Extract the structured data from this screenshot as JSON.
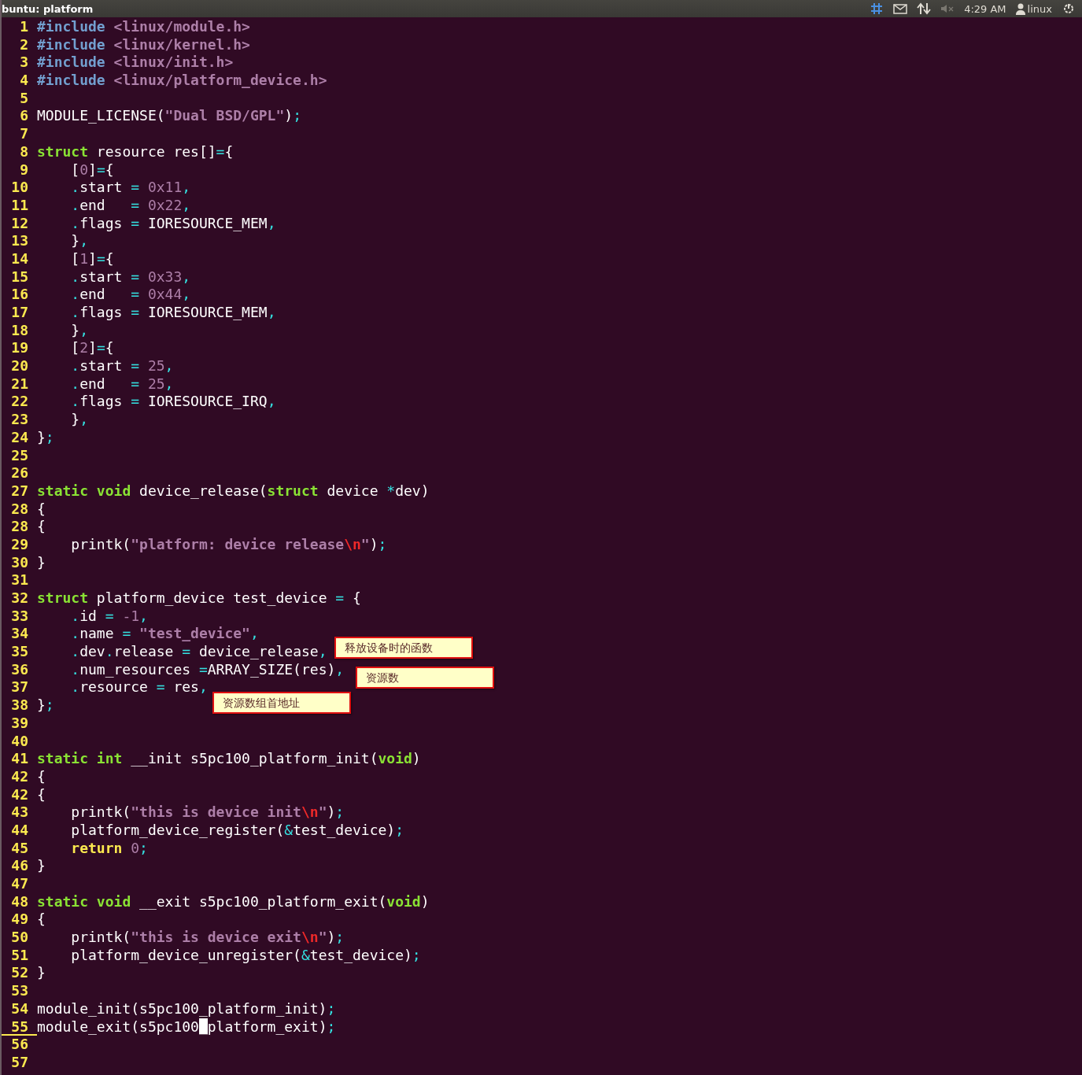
{
  "top_bar": {
    "title": "buntu: platform",
    "clock": "4:29 AM",
    "user": "linux"
  },
  "lines": [
    {
      "number": "1",
      "current": false,
      "tokens": [
        {
          "kind": "pre",
          "text": "#include"
        },
        {
          "kind": "str",
          "text": " <linux/module.h>"
        }
      ]
    },
    {
      "number": "2",
      "current": false,
      "tokens": [
        {
          "kind": "pre",
          "text": "#include"
        },
        {
          "kind": "str",
          "text": " <linux/kernel.h>"
        }
      ]
    },
    {
      "number": "3",
      "current": false,
      "tokens": [
        {
          "kind": "pre",
          "text": "#include"
        },
        {
          "kind": "str",
          "text": " <linux/init.h>"
        }
      ]
    },
    {
      "number": "4",
      "current": false,
      "tokens": [
        {
          "kind": "pre",
          "text": "#include"
        },
        {
          "kind": "str",
          "text": " <linux/platform_device.h>"
        }
      ]
    },
    {
      "number": "5",
      "current": false
    },
    {
      "number": "6",
      "current": false,
      "tokens": [
        {
          "kind": "plain",
          "text": "MODULE_LICENSE("
        },
        {
          "kind": "str",
          "text": "\"Dual BSD/GPL\""
        },
        {
          "kind": "plain",
          "text": ")"
        },
        {
          "kind": "op",
          "text": ";"
        }
      ]
    },
    {
      "number": "7",
      "current": false
    },
    {
      "number": "8",
      "current": false,
      "tokens": [
        {
          "kind": "kw",
          "text": "struct"
        },
        {
          "kind": "plain",
          "text": " resource res[]"
        },
        {
          "kind": "op",
          "text": "="
        },
        {
          "kind": "plain",
          "text": "{"
        }
      ]
    },
    {
      "number": "9",
      "current": false,
      "tokens": [
        {
          "kind": "plain",
          "text": "    ["
        },
        {
          "kind": "num",
          "text": "0"
        },
        {
          "kind": "plain",
          "text": "]"
        },
        {
          "kind": "op",
          "text": "="
        },
        {
          "kind": "plain",
          "text": "{"
        }
      ]
    },
    {
      "number": "10",
      "current": false,
      "tokens": [
        {
          "kind": "op",
          "text": "    ."
        },
        {
          "kind": "plain",
          "text": "start "
        },
        {
          "kind": "op",
          "text": "= "
        },
        {
          "kind": "num",
          "text": "0x11"
        },
        {
          "kind": "op",
          "text": ","
        }
      ]
    },
    {
      "number": "11",
      "current": false,
      "tokens": [
        {
          "kind": "op",
          "text": "    ."
        },
        {
          "kind": "plain",
          "text": "end   "
        },
        {
          "kind": "op",
          "text": "= "
        },
        {
          "kind": "num",
          "text": "0x22"
        },
        {
          "kind": "op",
          "text": ","
        }
      ]
    },
    {
      "number": "12",
      "current": false,
      "tokens": [
        {
          "kind": "op",
          "text": "    ."
        },
        {
          "kind": "plain",
          "text": "flags "
        },
        {
          "kind": "op",
          "text": "="
        },
        {
          "kind": "plain",
          "text": " IORESOURCE_MEM"
        },
        {
          "kind": "op",
          "text": ","
        }
      ]
    },
    {
      "number": "13",
      "current": false,
      "tokens": [
        {
          "kind": "plain",
          "text": "    }"
        },
        {
          "kind": "op",
          "text": ","
        }
      ]
    },
    {
      "number": "14",
      "current": false,
      "tokens": [
        {
          "kind": "plain",
          "text": "    ["
        },
        {
          "kind": "num",
          "text": "1"
        },
        {
          "kind": "plain",
          "text": "]"
        },
        {
          "kind": "op",
          "text": "="
        },
        {
          "kind": "plain",
          "text": "{"
        }
      ]
    },
    {
      "number": "15",
      "current": false,
      "tokens": [
        {
          "kind": "op",
          "text": "    ."
        },
        {
          "kind": "plain",
          "text": "start "
        },
        {
          "kind": "op",
          "text": "= "
        },
        {
          "kind": "num",
          "text": "0x33"
        },
        {
          "kind": "op",
          "text": ","
        }
      ]
    },
    {
      "number": "16",
      "current": false,
      "tokens": [
        {
          "kind": "op",
          "text": "    ."
        },
        {
          "kind": "plain",
          "text": "end   "
        },
        {
          "kind": "op",
          "text": "= "
        },
        {
          "kind": "num",
          "text": "0x44"
        },
        {
          "kind": "op",
          "text": ","
        }
      ]
    },
    {
      "number": "17",
      "current": false,
      "tokens": [
        {
          "kind": "op",
          "text": "    ."
        },
        {
          "kind": "plain",
          "text": "flags "
        },
        {
          "kind": "op",
          "text": "="
        },
        {
          "kind": "plain",
          "text": " IORESOURCE_MEM"
        },
        {
          "kind": "op",
          "text": ","
        }
      ]
    },
    {
      "number": "18",
      "current": false,
      "tokens": [
        {
          "kind": "plain",
          "text": "    }"
        },
        {
          "kind": "op",
          "text": ","
        }
      ]
    },
    {
      "number": "19",
      "current": false,
      "tokens": [
        {
          "kind": "plain",
          "text": "    ["
        },
        {
          "kind": "num",
          "text": "2"
        },
        {
          "kind": "plain",
          "text": "]"
        },
        {
          "kind": "op",
          "text": "="
        },
        {
          "kind": "plain",
          "text": "{"
        }
      ]
    },
    {
      "number": "20",
      "current": false,
      "tokens": [
        {
          "kind": "op",
          "text": "    ."
        },
        {
          "kind": "plain",
          "text": "start "
        },
        {
          "kind": "op",
          "text": "= "
        },
        {
          "kind": "num",
          "text": "25"
        },
        {
          "kind": "op",
          "text": ","
        }
      ]
    },
    {
      "number": "21",
      "current": false,
      "tokens": [
        {
          "kind": "op",
          "text": "    ."
        },
        {
          "kind": "plain",
          "text": "end   "
        },
        {
          "kind": "op",
          "text": "= "
        },
        {
          "kind": "num",
          "text": "25"
        },
        {
          "kind": "op",
          "text": ","
        }
      ]
    },
    {
      "number": "22",
      "current": false,
      "tokens": [
        {
          "kind": "op",
          "text": "    ."
        },
        {
          "kind": "plain",
          "text": "flags "
        },
        {
          "kind": "op",
          "text": "="
        },
        {
          "kind": "plain",
          "text": " IORESOURCE_IRQ"
        },
        {
          "kind": "op",
          "text": ","
        }
      ]
    },
    {
      "number": "23",
      "current": false,
      "tokens": [
        {
          "kind": "plain",
          "text": "    }"
        },
        {
          "kind": "op",
          "text": ","
        }
      ]
    },
    {
      "number": "24",
      "current": false,
      "tokens": [
        {
          "kind": "plain",
          "text": "}"
        },
        {
          "kind": "op",
          "text": ";"
        }
      ]
    },
    {
      "number": "25",
      "current": false
    },
    {
      "number": "26",
      "current": false
    },
    {
      "number": "27",
      "current": false,
      "tokens": [
        {
          "kind": "kw",
          "text": "static"
        },
        {
          "kind": "kw",
          "text": " void"
        },
        {
          "kind": "plain",
          "text": " device_release("
        },
        {
          "kind": "kw",
          "text": "struct"
        },
        {
          "kind": "plain",
          "text": " device "
        },
        {
          "kind": "op",
          "text": "*"
        },
        {
          "kind": "plain",
          "text": "dev)"
        }
      ]
    },
    {
      "number": "28",
      "current": false,
      "tokens": [
        {
          "kind": "plain",
          "text": "{"
        }
      ]
    },
    {
      "number": "28",
      "current": false,
      "tokens": [
        {
          "kind": "plain",
          "text": "{"
        }
      ]
    },
    {
      "number": "29",
      "current": false,
      "tokens": [
        {
          "kind": "plain",
          "text": "    printk("
        },
        {
          "kind": "str",
          "text": "\"platform: device release"
        },
        {
          "kind": "esc",
          "text": "\\n"
        },
        {
          "kind": "str",
          "text": "\""
        },
        {
          "kind": "plain",
          "text": ")"
        },
        {
          "kind": "op",
          "text": ";"
        }
      ]
    },
    {
      "number": "30",
      "current": false,
      "tokens": [
        {
          "kind": "plain",
          "text": "}"
        }
      ]
    },
    {
      "number": "31",
      "current": false
    },
    {
      "number": "32",
      "current": false,
      "tokens": [
        {
          "kind": "kw",
          "text": "struct"
        },
        {
          "kind": "plain",
          "text": " platform_device test_device "
        },
        {
          "kind": "op",
          "text": "="
        },
        {
          "kind": "plain",
          "text": " {"
        }
      ]
    },
    {
      "number": "33",
      "current": false,
      "tokens": [
        {
          "kind": "op",
          "text": "    ."
        },
        {
          "kind": "plain",
          "text": "id "
        },
        {
          "kind": "op",
          "text": "= "
        },
        {
          "kind": "num",
          "text": "-1"
        },
        {
          "kind": "op",
          "text": ","
        }
      ]
    },
    {
      "number": "34",
      "current": false,
      "tokens": [
        {
          "kind": "op",
          "text": "    ."
        },
        {
          "kind": "plain",
          "text": "name "
        },
        {
          "kind": "op",
          "text": "= "
        },
        {
          "kind": "str",
          "text": "\"test_device\""
        },
        {
          "kind": "op",
          "text": ","
        }
      ]
    },
    {
      "number": "35",
      "current": false,
      "tokens": [
        {
          "kind": "op",
          "text": "    ."
        },
        {
          "kind": "plain",
          "text": "dev"
        },
        {
          "kind": "op",
          "text": "."
        },
        {
          "kind": "plain",
          "text": "release "
        },
        {
          "kind": "op",
          "text": "="
        },
        {
          "kind": "plain",
          "text": " device_release"
        },
        {
          "kind": "op",
          "text": ","
        }
      ]
    },
    {
      "number": "36",
      "current": false,
      "tokens": [
        {
          "kind": "op",
          "text": "    ."
        },
        {
          "kind": "plain",
          "text": "num_resources "
        },
        {
          "kind": "op",
          "text": "="
        },
        {
          "kind": "plain",
          "text": "ARRAY_SIZE(res)"
        },
        {
          "kind": "op",
          "text": ","
        }
      ]
    },
    {
      "number": "37",
      "current": false,
      "tokens": [
        {
          "kind": "op",
          "text": "    ."
        },
        {
          "kind": "plain",
          "text": "resource "
        },
        {
          "kind": "op",
          "text": "="
        },
        {
          "kind": "plain",
          "text": " res"
        },
        {
          "kind": "op",
          "text": ","
        }
      ]
    },
    {
      "number": "38",
      "current": false,
      "tokens": [
        {
          "kind": "plain",
          "text": "}"
        },
        {
          "kind": "op",
          "text": ";"
        }
      ]
    },
    {
      "number": "39",
      "current": false
    },
    {
      "number": "40",
      "current": false
    },
    {
      "number": "41",
      "current": false,
      "tokens": [
        {
          "kind": "kw",
          "text": "static"
        },
        {
          "kind": "kw",
          "text": " int"
        },
        {
          "kind": "plain",
          "text": " __init s5pc100_platform_init("
        },
        {
          "kind": "kw",
          "text": "void"
        },
        {
          "kind": "plain",
          "text": ")"
        }
      ]
    },
    {
      "number": "42",
      "current": false,
      "tokens": [
        {
          "kind": "plain",
          "text": "{"
        }
      ]
    },
    {
      "number": "42",
      "current": false,
      "tokens": [
        {
          "kind": "plain",
          "text": "{"
        }
      ]
    },
    {
      "number": "43",
      "current": false,
      "tokens": [
        {
          "kind": "plain",
          "text": "    printk("
        },
        {
          "kind": "str",
          "text": "\"this is device init"
        },
        {
          "kind": "esc",
          "text": "\\n"
        },
        {
          "kind": "str",
          "text": "\""
        },
        {
          "kind": "plain",
          "text": ")"
        },
        {
          "kind": "op",
          "text": ";"
        }
      ]
    },
    {
      "number": "44",
      "current": false,
      "tokens": [
        {
          "kind": "plain",
          "text": "    platform_device_register("
        },
        {
          "kind": "op",
          "text": "&"
        },
        {
          "kind": "plain",
          "text": "test_device)"
        },
        {
          "kind": "op",
          "text": ";"
        }
      ]
    },
    {
      "number": "45",
      "current": false,
      "tokens": [
        {
          "kind": "ret",
          "text": "    return"
        },
        {
          "kind": "num",
          "text": " 0"
        },
        {
          "kind": "op",
          "text": ";"
        }
      ]
    },
    {
      "number": "46",
      "current": false,
      "tokens": [
        {
          "kind": "plain",
          "text": "}"
        }
      ]
    },
    {
      "number": "47",
      "current": false
    },
    {
      "number": "48",
      "current": false,
      "tokens": [
        {
          "kind": "kw",
          "text": "static"
        },
        {
          "kind": "kw",
          "text": " void"
        },
        {
          "kind": "plain",
          "text": " __exit s5pc100_platform_exit("
        },
        {
          "kind": "kw",
          "text": "void"
        },
        {
          "kind": "plain",
          "text": ")"
        }
      ]
    },
    {
      "number": "49",
      "current": false,
      "tokens": [
        {
          "kind": "plain",
          "text": "{"
        }
      ]
    },
    {
      "number": "50",
      "current": false,
      "tokens": [
        {
          "kind": "plain",
          "text": "    printk("
        },
        {
          "kind": "str",
          "text": "\"this is device exit"
        },
        {
          "kind": "esc",
          "text": "\\n"
        },
        {
          "kind": "str",
          "text": "\""
        },
        {
          "kind": "plain",
          "text": ")"
        },
        {
          "kind": "op",
          "text": ";"
        }
      ]
    },
    {
      "number": "51",
      "current": false,
      "tokens": [
        {
          "kind": "plain",
          "text": "    platform_device_unregister("
        },
        {
          "kind": "op",
          "text": "&"
        },
        {
          "kind": "plain",
          "text": "test_device)"
        },
        {
          "kind": "op",
          "text": ";"
        }
      ]
    },
    {
      "number": "52",
      "current": false,
      "tokens": [
        {
          "kind": "plain",
          "text": "}"
        }
      ]
    },
    {
      "number": "53",
      "current": false
    },
    {
      "number": "54",
      "current": false,
      "tokens": [
        {
          "kind": "plain",
          "text": "module_init(s5pc100_platform_init)"
        },
        {
          "kind": "op",
          "text": ";"
        }
      ]
    },
    {
      "number": "55",
      "current": true,
      "tokens": [
        {
          "kind": "plain",
          "text": "module_exit(s5pc100"
        },
        {
          "kind": "cursor",
          "text": "_"
        },
        {
          "kind": "plain",
          "text": "platform_exit)"
        },
        {
          "kind": "op",
          "text": ";"
        }
      ]
    },
    {
      "number": "56",
      "current": false
    },
    {
      "number": "57",
      "current": false
    }
  ],
  "annotations": [
    {
      "text": "释放设备时的函数"
    },
    {
      "text": "资源数"
    },
    {
      "text": "资源数组首地址"
    }
  ]
}
